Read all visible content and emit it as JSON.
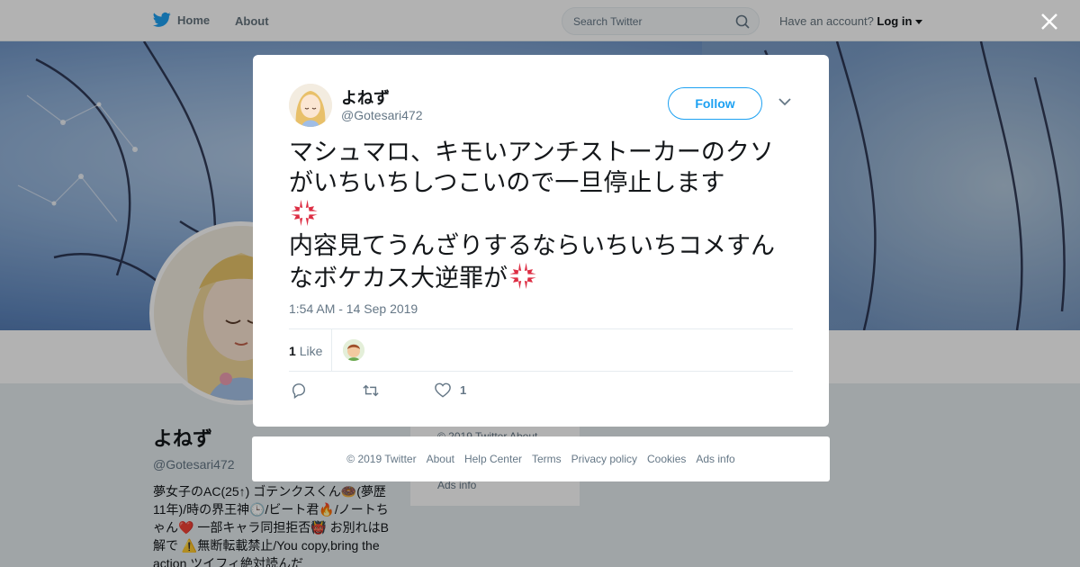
{
  "topbar": {
    "home_label": "Home",
    "about_label": "About",
    "search_placeholder": "Search Twitter",
    "account_prompt": "Have an account?",
    "login_label": "Log in"
  },
  "profile": {
    "name": "よねず",
    "handle": "@Gotesari472",
    "bio": "夢女子のAC(25↑) ゴテンクスくん🍩(夢歴11年)/時の界王神🕒/ビート君🔥/ノートちゃん❤️ 一部キャラ同担拒否👹 お別れはB解で ⚠️無断転載禁止/You copy,bring the action ツイフィ絶対読んだ"
  },
  "mid_card": {
    "line1": "© 2019 Twitter   About",
    "line2": "Ads info"
  },
  "tweet": {
    "name": "よねず",
    "handle": "@Gotesari472",
    "follow_label": "Follow",
    "text_part1": "マシュマロ、キモいアンチストーカーのクソがいちいちしつこいので一旦停止します",
    "text_part2": "内容見てうんざりするならいちいちコメすんなボケカス大逆罪が",
    "timestamp": "1:54 AM - 14 Sep 2019",
    "like_count": "1",
    "like_label": "Like",
    "action_like_count": "1"
  },
  "footer": {
    "copyright": "© 2019 Twitter",
    "about": "About",
    "help": "Help Center",
    "terms": "Terms",
    "privacy": "Privacy policy",
    "cookies": "Cookies",
    "ads": "Ads info"
  },
  "colors": {
    "accent": "#1da1f2",
    "anger_red": "#e0245e",
    "muted": "#657786"
  }
}
